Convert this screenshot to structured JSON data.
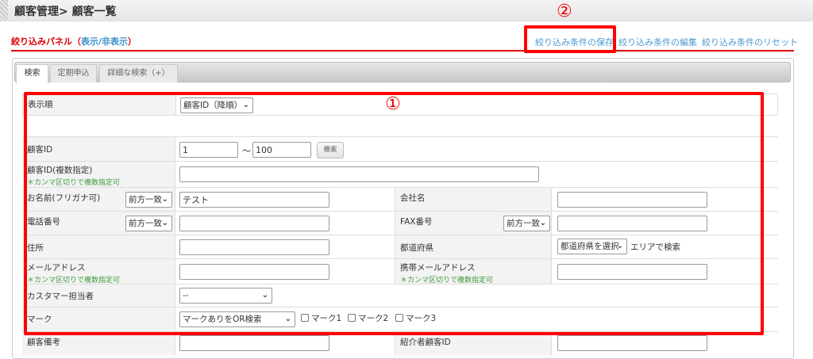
{
  "header": {
    "title": "顧客管理> 顧客一覧"
  },
  "panel": {
    "title": "絞り込みパネル（",
    "toggle": "表示/非表示",
    "title_end": "）",
    "links": [
      "絞り込み条件の保存",
      "絞り込み条件の編集",
      "絞り込み条件のリセット"
    ]
  },
  "tabs": [
    "検索",
    "定期申込",
    "詳細な検索（+）"
  ],
  "annotations": {
    "one": "①",
    "two": "②",
    "color": "#ff0000"
  },
  "form": {
    "sort": {
      "label": "表示順",
      "value": "顧客ID（降順）"
    },
    "customer_id": {
      "label": "顧客ID",
      "from": "1",
      "sep": "～",
      "to": "100",
      "button": "検索"
    },
    "customer_id_multi": {
      "label": "顧客ID(複数指定)",
      "note": "＊カンマ区切りで複数指定可",
      "value": ""
    },
    "name": {
      "label": "お名前(フリガナ可)",
      "match": "前方一致",
      "value": "テスト"
    },
    "company": {
      "label": "会社名",
      "value": ""
    },
    "phone": {
      "label": "電話番号",
      "match": "前方一致",
      "value": ""
    },
    "fax": {
      "label": "FAX番号",
      "match": "前方一致",
      "value": ""
    },
    "address": {
      "label": "住所",
      "value": ""
    },
    "prefecture": {
      "label": "都道府県",
      "value": "都道府県を選択",
      "suffix": "エリアで検索"
    },
    "email": {
      "label": "メールアドレス",
      "note": "＊カンマ区切りで複数指定可",
      "value": ""
    },
    "mobile_email": {
      "label": "携帯メールアドレス",
      "note": "＊カンマ区切りで複数指定可",
      "value": ""
    },
    "staff": {
      "label": "カスタマー担当者",
      "value": "--"
    },
    "mark": {
      "label": "マーク",
      "value": "マークありをOR検索",
      "checks": [
        "マーク1",
        "マーク2",
        "マーク3"
      ]
    },
    "remarks": {
      "label": "顧客備考",
      "value": ""
    },
    "referrer": {
      "label": "紹介者顧客ID",
      "value": ""
    }
  }
}
